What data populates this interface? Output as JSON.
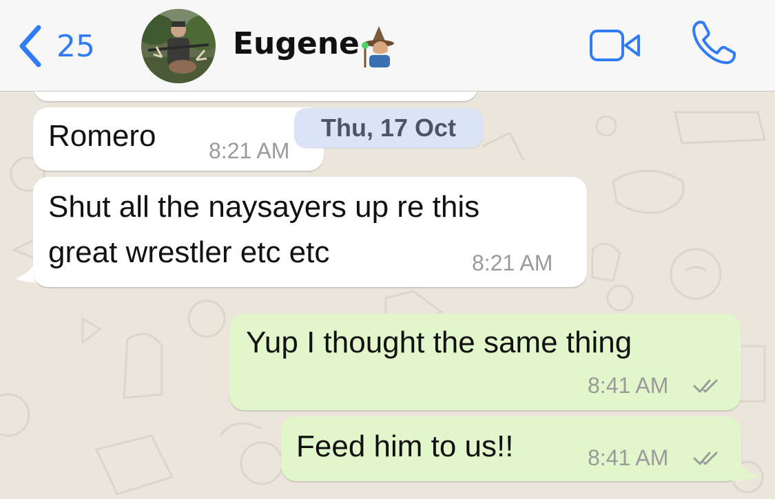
{
  "header": {
    "back_count": "25",
    "contact_name": "Eugene",
    "contact_emoji": "wizard-emoji"
  },
  "icons": {
    "back": "chevron-left-icon",
    "video": "video-camera-icon",
    "call": "phone-icon",
    "read": "double-check-icon"
  },
  "colors": {
    "accent": "#2f7cf6",
    "incoming_bubble": "#ffffff",
    "outgoing_bubble": "#e1f6cb",
    "date_pill": "#dbe3f7",
    "wallpaper": "#ebe5dc"
  },
  "date_separator": "Thu, 17 Oct",
  "messages": [
    {
      "direction": "incoming",
      "text": "Romero",
      "time": "8:21 AM"
    },
    {
      "direction": "incoming",
      "lines": [
        "Shut all the naysayers up re this",
        "great wrestler etc etc"
      ],
      "time": "8:21 AM"
    },
    {
      "direction": "outgoing",
      "text": "Yup I thought the same thing",
      "time": "8:41 AM",
      "status": "read"
    },
    {
      "direction": "outgoing",
      "text": "Feed him to us!!",
      "time": "8:41 AM",
      "status": "read"
    }
  ]
}
